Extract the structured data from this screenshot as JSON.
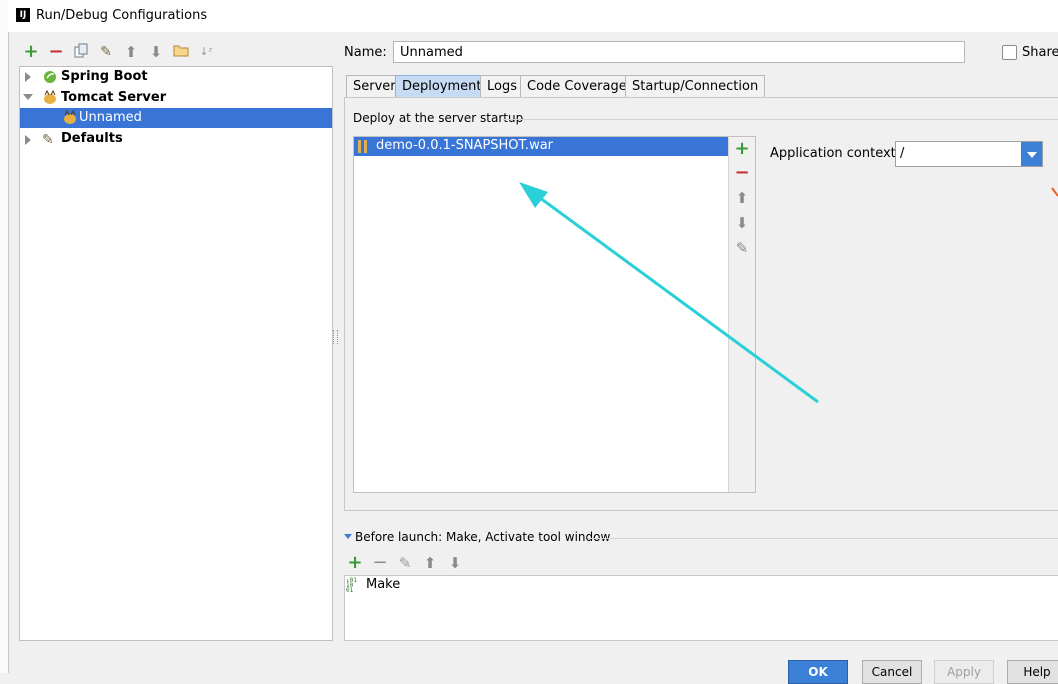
{
  "window": {
    "title": "Run/Debug Configurations",
    "icon": "IJ"
  },
  "toolbar": {
    "icons": [
      "add-icon",
      "remove-icon",
      "copy-icon",
      "wrench-icon",
      "move-up-icon",
      "move-down-icon",
      "folder-icon",
      "sort-icon"
    ]
  },
  "tree": {
    "items": [
      {
        "label": "Spring Boot",
        "expanded": false,
        "icon": "spring-boot-icon"
      },
      {
        "label": "Tomcat Server",
        "expanded": true,
        "icon": "tomcat-icon"
      },
      {
        "label": "Unnamed",
        "selected": true,
        "icon": "tomcat-config-icon"
      },
      {
        "label": "Defaults",
        "expanded": false,
        "icon": "wrench-icon"
      }
    ]
  },
  "form": {
    "name_label": "Name:",
    "name_value": "Unnamed",
    "share_label": "Share"
  },
  "tabs": [
    {
      "label": "Server",
      "active": false
    },
    {
      "label": "Deployment",
      "active": true
    },
    {
      "label": "Logs",
      "active": false
    },
    {
      "label": "Code Coverage",
      "active": false
    },
    {
      "label": "Startup/Connection",
      "active": false
    }
  ],
  "deployment": {
    "section_title": "Deploy at the server startup",
    "artifacts": [
      "demo-0.0.1-SNAPSHOT.war"
    ],
    "context_label": "Application context:",
    "context_value": "/"
  },
  "before_launch": {
    "title": "Before launch: Make, Activate tool window",
    "tasks": [
      "Make"
    ]
  },
  "buttons": {
    "ok": "OK",
    "cancel": "Cancel",
    "apply": "Apply",
    "help": "Help"
  },
  "colors": {
    "selection": "#3875d7",
    "accent": "#3c7fd6",
    "annotation_arrow": "#2ad0d8",
    "tab_active": "#c7dbf5"
  }
}
